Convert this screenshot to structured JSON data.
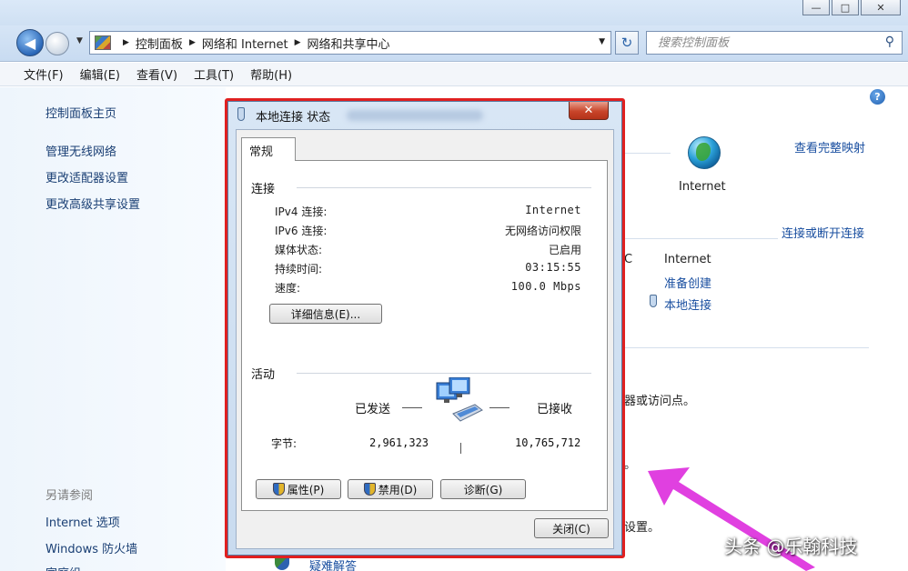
{
  "window": {
    "minimize": "—",
    "maximize": "□",
    "close": "✕"
  },
  "address": {
    "breadcrumbs": [
      "控制面板",
      "网络和 Internet",
      "网络和共享中心"
    ],
    "search_placeholder": "搜索控制面板"
  },
  "menu": [
    "文件(F)",
    "编辑(E)",
    "查看(V)",
    "工具(T)",
    "帮助(H)"
  ],
  "sidebar": {
    "home": "控制面板主页",
    "items": [
      "管理无线网络",
      "更改适配器设置",
      "更改高级共享设置"
    ],
    "see_also_title": "另请参阅",
    "see_also": [
      "Internet 选项",
      "Windows 防火墙",
      "家庭组"
    ]
  },
  "main": {
    "help": "?",
    "view_full_map": "查看完整映射",
    "internet_label": "Internet",
    "connect_disconnect": "连接或断开连接",
    "access_type_value": "Internet",
    "ready_create": "准备创建",
    "local_connection": "本地连接",
    "partial_text_1": "器或访问点。",
    "partial_text_2": "。",
    "partial_text_3": "设置。",
    "fragment_ce": "C",
    "troubleshoot": "疑难解答"
  },
  "dialog": {
    "title": "本地连接 状态",
    "close": "✕",
    "tab": "常规",
    "connection": {
      "title": "连接",
      "rows": [
        {
          "label": "IPv4 连接:",
          "value": "Internet"
        },
        {
          "label": "IPv6 连接:",
          "value": "无网络访问权限"
        },
        {
          "label": "媒体状态:",
          "value": "已启用"
        },
        {
          "label": "持续时间:",
          "value": "03:15:55"
        },
        {
          "label": "速度:",
          "value": "100.0 Mbps"
        }
      ],
      "details_button": "详细信息(E)..."
    },
    "activity": {
      "title": "活动",
      "sent_label": "已发送",
      "received_label": "已接收",
      "bytes_label": "字节:",
      "sent_bytes": "2,961,323",
      "received_bytes": "10,765,712"
    },
    "buttons": {
      "properties": "属性(P)",
      "disable": "禁用(D)",
      "diagnose": "诊断(G)",
      "close": "关闭(C)"
    }
  },
  "watermark": "头条 @乐翰科技",
  "colors": {
    "highlight": "#e02020",
    "arrow": "#e040e0",
    "link": "#1a4fa0"
  }
}
